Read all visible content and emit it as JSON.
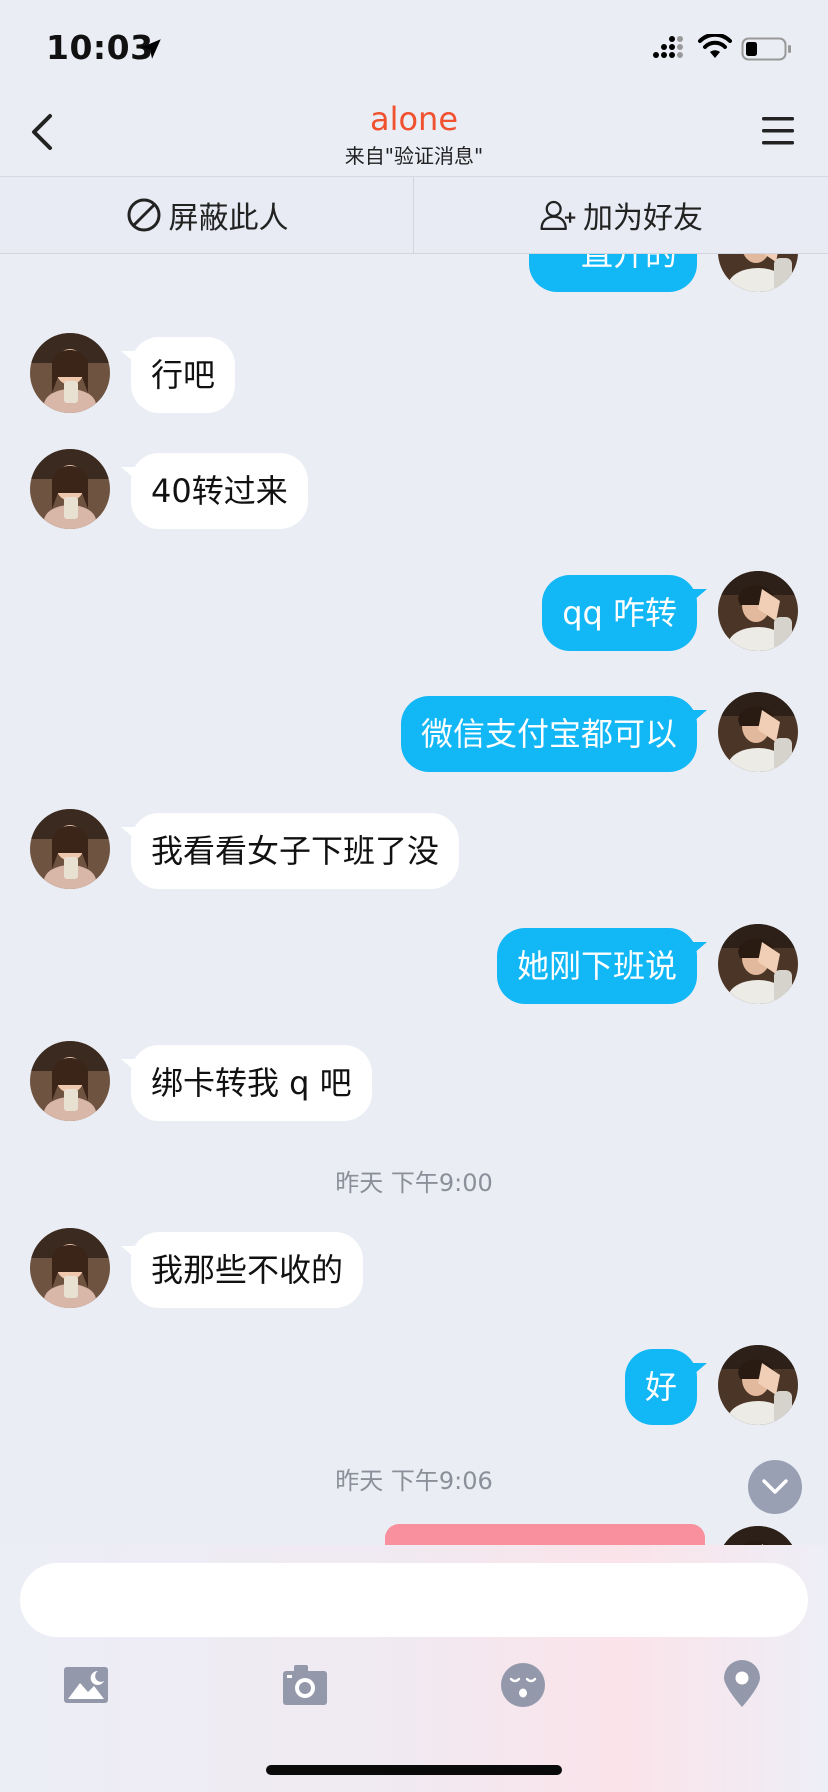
{
  "status": {
    "time": "10:03"
  },
  "header": {
    "title": "alone",
    "subtitle": "来自\"验证消息\""
  },
  "actions": {
    "block": "屏蔽此人",
    "add_friend": "加为好友"
  },
  "messages": [
    {
      "side": "out",
      "text": "一直开的"
    },
    {
      "side": "in",
      "text": "行吧"
    },
    {
      "side": "in",
      "text": "40转过来"
    },
    {
      "side": "out",
      "text": "qq 咋转"
    },
    {
      "side": "out",
      "text": "微信支付宝都可以"
    },
    {
      "side": "in",
      "text": "我看看女子下班了没"
    },
    {
      "side": "out",
      "text": "她刚下班说"
    },
    {
      "side": "in",
      "text": "绑卡转我 q 吧"
    },
    {
      "side": "in",
      "text": "我那些不收的"
    },
    {
      "side": "out",
      "text": "好"
    }
  ],
  "timestamps": [
    "昨天 下午9:00",
    "昨天 下午9:06"
  ],
  "input": {
    "placeholder": ""
  },
  "toolbar": {
    "icons": [
      "image-icon",
      "camera-icon",
      "emoji-icon",
      "location-icon"
    ]
  },
  "colors": {
    "title": "#f0512f",
    "outgoing_bubble": "#12b7f5",
    "incoming_bubble": "#ffffff",
    "background": "#ebedf5",
    "card": "#f8909d"
  }
}
